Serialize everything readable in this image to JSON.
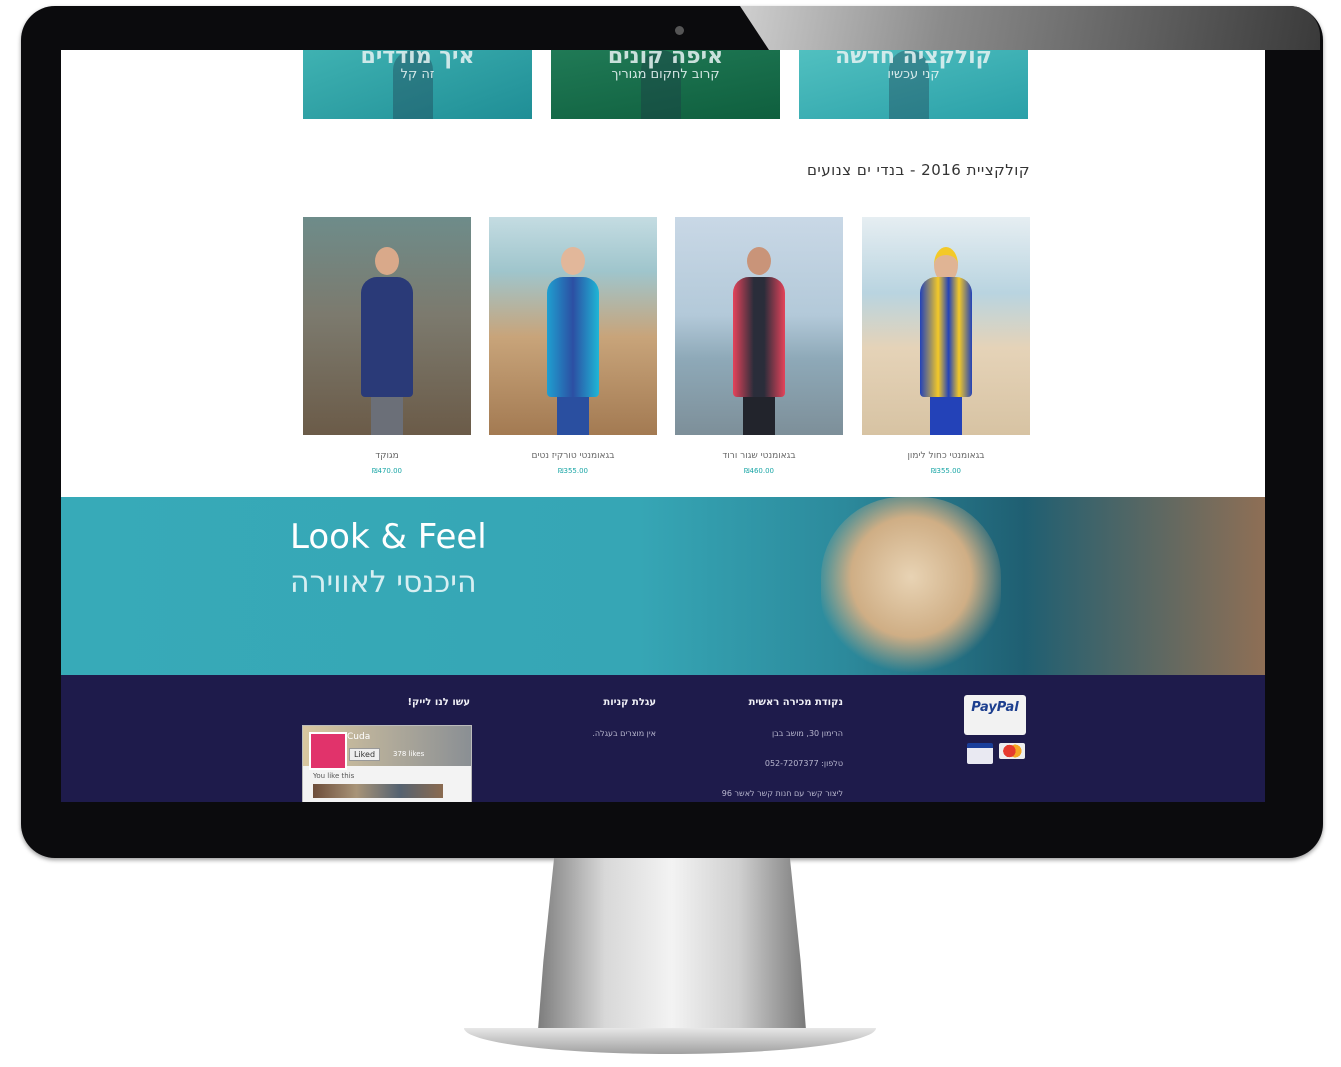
{
  "banners": [
    {
      "title": "איך מודדים",
      "subtitle": "זה קל"
    },
    {
      "title": "איפה קונים",
      "subtitle": "קרוב לחקום מגוריך"
    },
    {
      "title": "קולקציה חדשה",
      "subtitle": "קני עכשיו"
    }
  ],
  "collection": {
    "title": "קולקציית 2016 - בנדי ים צנועים",
    "products": [
      {
        "name": "מגוקד",
        "price": "₪470.00"
      },
      {
        "name": "בגאומנטי טורקיז נטים",
        "price": "₪355.00"
      },
      {
        "name": "בגאומנטי שגור ורוד",
        "price": "₪460.00"
      },
      {
        "name": "בגאומנטי כחול לימון",
        "price": "₪355.00"
      }
    ]
  },
  "hero": {
    "line1": "Look & Feel",
    "line2": "היכנסי לאווירה"
  },
  "footer": {
    "social_heading": "עשו לנו לייק!",
    "cart_heading": "עגלת קניות",
    "cart_text": "אין מוצרים בעגלה.",
    "store_heading": "נקודת מכירה ראשית",
    "store_lines": [
      "הרימון 30, מושב בבן",
      "טלפון: 052-7207377",
      "ליצור קשר עם חנות קשר לאשר 96"
    ],
    "paypal_label": "PayPal",
    "facebook": {
      "page_name": "Cuda",
      "like_label": "Liked",
      "count": "378 likes",
      "friends": "You like this"
    }
  },
  "colors": {
    "accent": "#37aab8",
    "footer_bg": "#1e1b4b",
    "price": "#1aa6a6"
  }
}
